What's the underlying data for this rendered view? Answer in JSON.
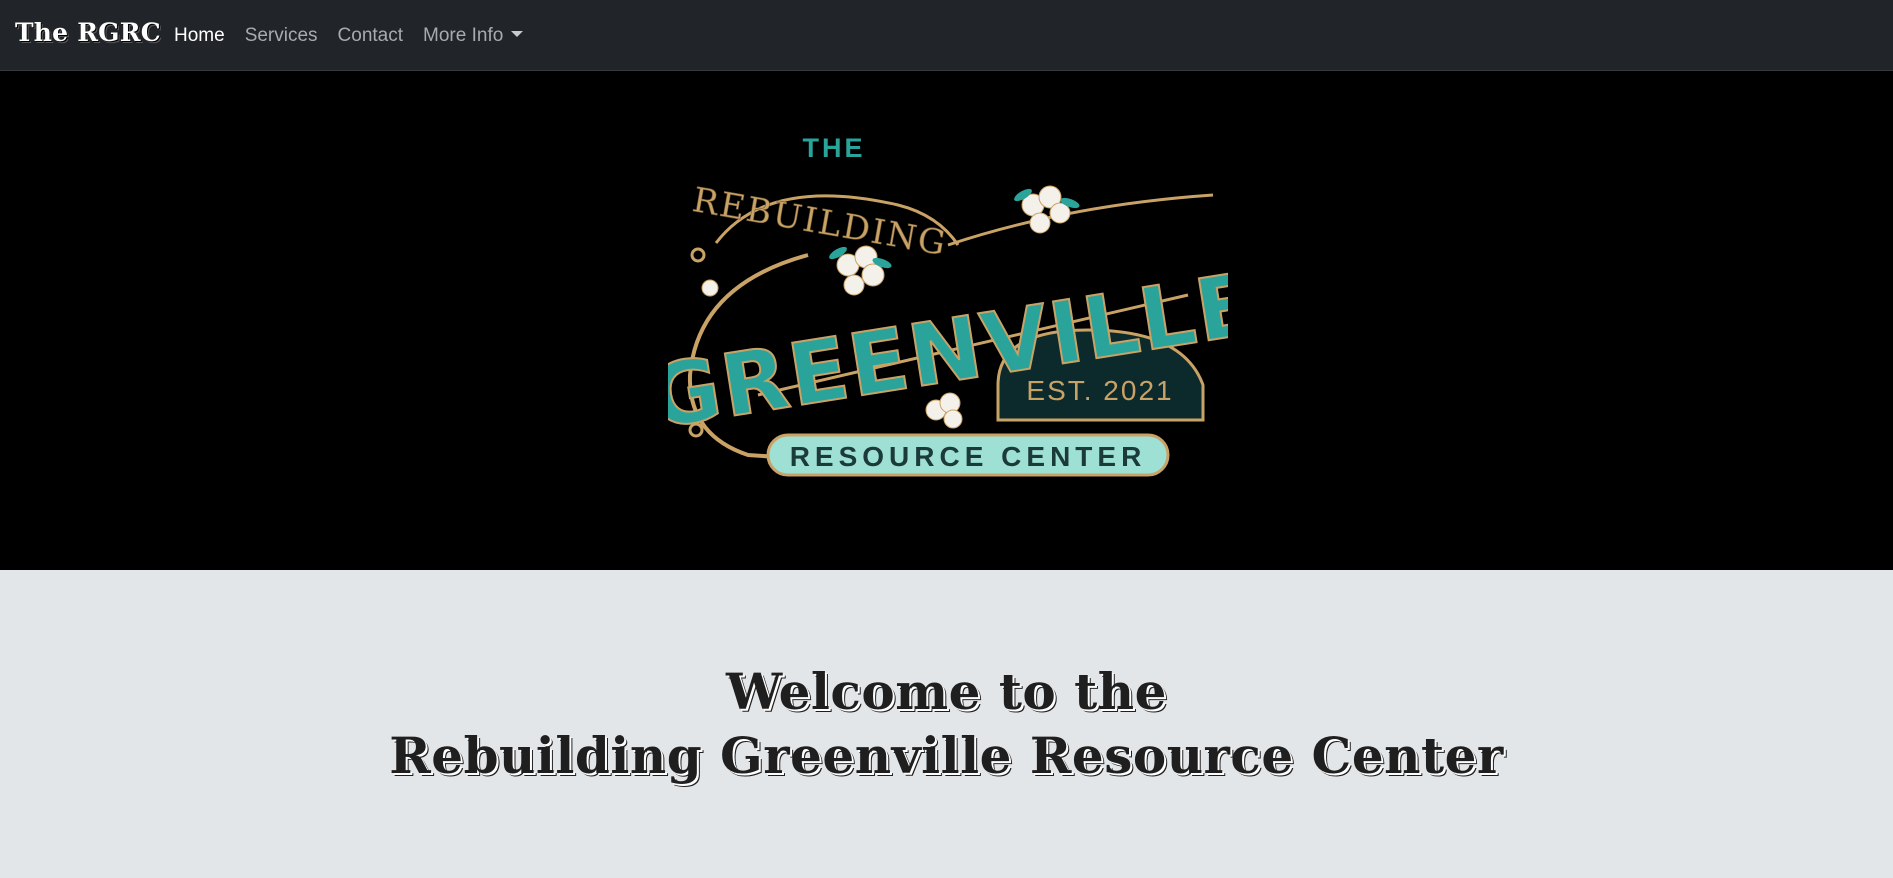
{
  "navbar": {
    "brand": "The RGRC",
    "links": [
      {
        "label": "Home",
        "active": true
      },
      {
        "label": "Services",
        "active": false
      },
      {
        "label": "Contact",
        "active": false
      },
      {
        "label": "More Info",
        "active": false,
        "dropdown": true
      }
    ]
  },
  "hero": {
    "logo": {
      "line_the": "THE",
      "line_rebuilding": "REBUILDING",
      "line_greenville": "GREENVILLE",
      "line_est": "EST. 2021",
      "line_resource": "RESOURCE CENTER"
    }
  },
  "welcome": {
    "line1": "Welcome to the",
    "line2": "Rebuilding Greenville Resource Center"
  },
  "colors": {
    "navbar_bg": "#212529",
    "hero_bg": "#000000",
    "welcome_bg": "#e3e6e9",
    "logo_teal": "#2aa39a",
    "logo_gold": "#c9a266",
    "logo_mint": "#9fe0d4"
  }
}
